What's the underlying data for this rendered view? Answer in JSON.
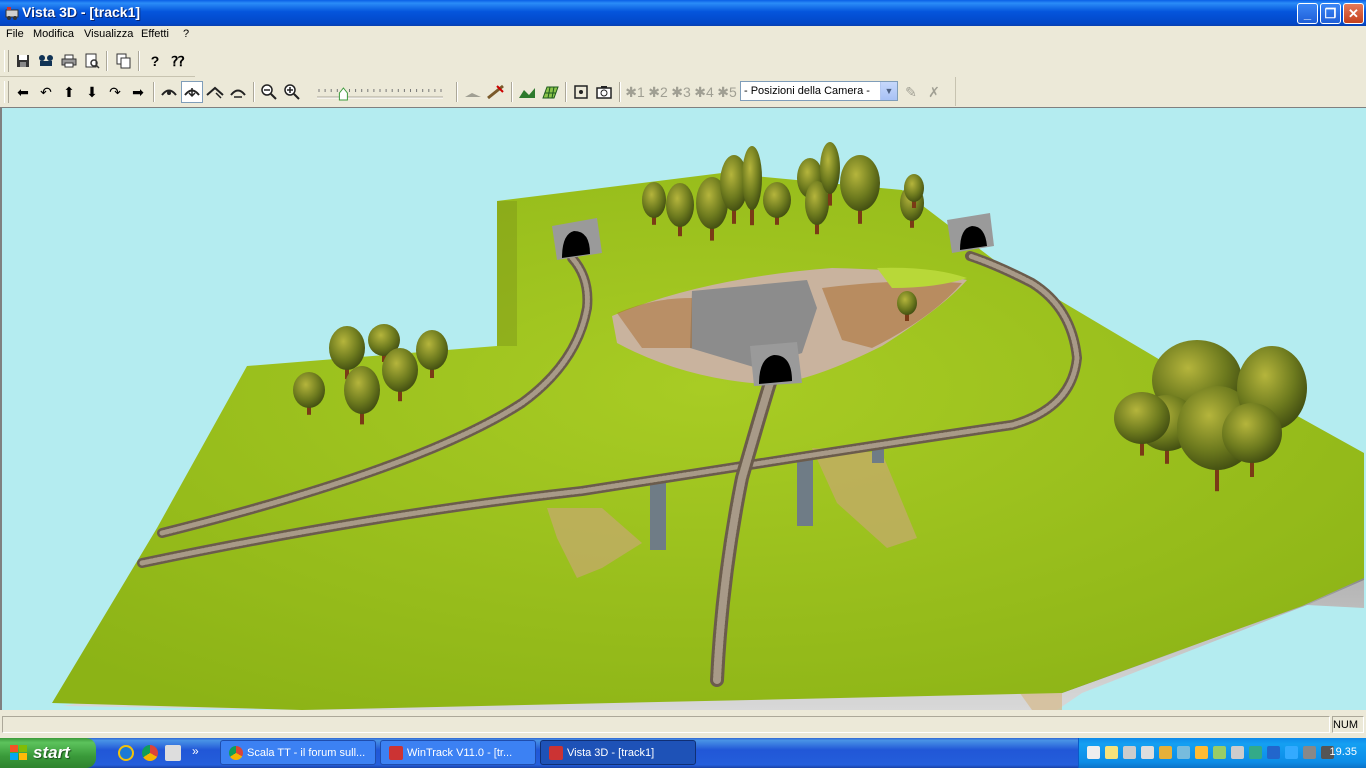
{
  "window": {
    "title": "Vista 3D - [track1]"
  },
  "menu": [
    "File",
    "Modifica",
    "Visualizza",
    "Effetti",
    "?"
  ],
  "camera_select": {
    "value": "- Posizioni della Camera -"
  },
  "camera_slots": [
    "1",
    "2",
    "3",
    "4",
    "5"
  ],
  "zoom_slider": {
    "position": 0.2
  },
  "status": {
    "num": "NUM"
  },
  "taskbar": {
    "start_label": "start",
    "tasks": [
      {
        "label": "Scala TT - il forum sull..."
      },
      {
        "label": "WinTrack  V11.0 - [tr..."
      },
      {
        "label": "Vista 3D - [track1]"
      }
    ],
    "clock": "19.35"
  },
  "colors": {
    "sky": "#b4ecf0",
    "grass": "#9ac21c",
    "cliff": "#a8a8a8",
    "track": "#7c6f5e",
    "titlebar": "#0a4fd8"
  },
  "icons": {
    "toolbar1": [
      "save-icon",
      "scenery-icon",
      "print-icon",
      "print-preview-icon",
      "copy-icon",
      "help-icon",
      "context-help-icon"
    ],
    "toolbar2": [
      "move-left-icon",
      "rotate-left-icon",
      "move-up-icon",
      "move-down-icon",
      "rotate-right-icon",
      "move-right-icon",
      "walk-mode-icon",
      "fly-mode-icon",
      "train-view-icon",
      "orbit-icon",
      "zoom-out-icon",
      "zoom-in-icon",
      "terrain-icon",
      "track-edit-icon",
      "landscape-icon",
      "grid-icon",
      "fit-view-icon",
      "camera-icon"
    ]
  }
}
